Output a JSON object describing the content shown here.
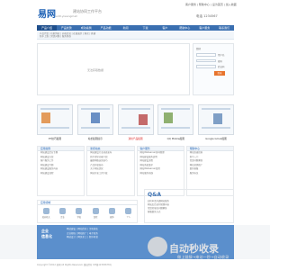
{
  "header": {
    "logo": "易网",
    "logo_sub": "edit.yiwangmall",
    "slogan": "建站协同工作平台",
    "top_links": "客户服务 | 帮助中心 | 设为首页 | 加入收藏",
    "phone": "电话 1234567"
  },
  "nav": {
    "items": [
      "产品介绍",
      "产品优势",
      "成功案例",
      "产品功能",
      "新闻",
      "下载",
      "客户",
      "帮助中心",
      "客户服务",
      "联系我们"
    ]
  },
  "subnav": {
    "lines": [
      "产品介绍 | 功能列表 | 价格信息 | 在线演示 | 购买 | 开通",
      "新手上路 | 常见问题 | 服务条款"
    ]
  },
  "main": {
    "message": "无法获取数据"
  },
  "login": {
    "hello": "您好",
    "user_label": "用户名",
    "pass_label": "密码",
    "code_label": "验证码",
    "login_button": "登录"
  },
  "thumbs": [
    {
      "caption": "ET技巧截图"
    },
    {
      "caption": "站长截图展示"
    },
    {
      "caption": "通用产品截图"
    },
    {
      "caption": "QQ Mobile截图"
    },
    {
      "caption": "Google Gmail截图"
    }
  ],
  "columns": [
    {
      "title": "应用案例",
      "items": [
        "网站建设企业专题",
        "网站建设方案",
        "客户服务工作",
        "网站建设专题",
        "网站建设服务内容",
        "网站建设流程"
      ]
    },
    {
      "title": "新闻动态",
      "items": [
        "网站建设行业动态发布",
        "新手指导功能介绍",
        "最新网络运营技巧",
        "产品升级发布",
        "关于网站优化",
        "网站开发工具下载"
      ]
    },
    {
      "title": "客户服务",
      "items": [
        "网站Webserver协同管理",
        "网站建设服务说明",
        "网站建设流程",
        "网站系统维护",
        "网站Webserver使用",
        "网站服务热线"
      ]
    },
    {
      "title": "帮助中心",
      "items": [
        "网站快速指南",
        "新手入门",
        "常见问题解答",
        "网站营销推广",
        "联系客服",
        "服务协议"
      ]
    }
  ],
  "icons": {
    "title": "应用领域",
    "items": [
      "政府机关",
      "企业",
      "学校",
      "医院",
      "媒体",
      "个人"
    ]
  },
  "qa": {
    "title": "Q&A",
    "items": [
      "如何申请开通网站服务",
      "网站后台如何管理内容",
      "常见的域名问题解答",
      "客服联系方式"
    ]
  },
  "footer": {
    "brand_line1": "企业",
    "brand_line2": "信息化",
    "links": [
      "网站建设 | 网站优化 | 主机域名",
      "企业邮局 | 网站推广 | 电子商务",
      "网站设计 | 网页美工 | 程序开发"
    ],
    "copyright": "Copyright ©2012 易网 All Rights Reserved. 版权所有 ICP备12345678号"
  },
  "watermark": {
    "title": "自动秒收录",
    "subtitle": "做上链接→来访一秒→自动收录"
  },
  "colors": {
    "nav": "#3a6fb0",
    "accent": "#e8742c",
    "footer": "#5b8fcc"
  }
}
